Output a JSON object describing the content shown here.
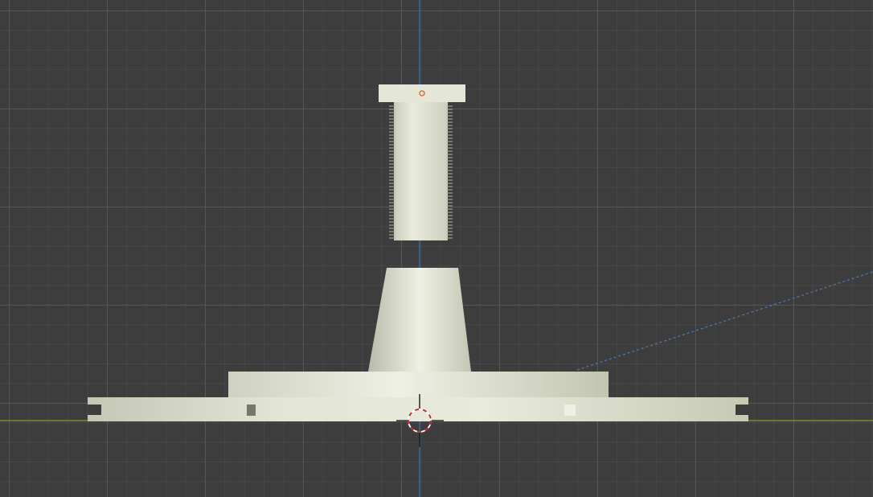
{
  "viewport": {
    "mode": "3d-viewport-front-orthographic",
    "background_color": "#3d3d3d",
    "grid_visible": true
  },
  "axes": {
    "x_axis_color": "#8a9a2b",
    "z_axis_color": "#2f6fa6"
  },
  "objects": [
    {
      "name": "threaded-bolt",
      "type": "mesh",
      "selected": true
    },
    {
      "name": "tapered-cone",
      "type": "mesh",
      "selected": false
    },
    {
      "name": "upper-disc",
      "type": "mesh",
      "selected": false
    },
    {
      "name": "lower-flange-plate",
      "type": "mesh",
      "selected": false
    }
  ],
  "colors": {
    "mesh_highlight": "#eceedd",
    "mesh_mid": "#d2d5c2",
    "mesh_shadow": "#b7bba6",
    "origin_dot": "#e07030",
    "cursor_red": "#c8202a",
    "cursor_white": "#ffffff",
    "light_line": "#4f7ab8"
  },
  "icons": {
    "cursor": "3d-cursor-icon",
    "origin": "object-origin-icon"
  }
}
